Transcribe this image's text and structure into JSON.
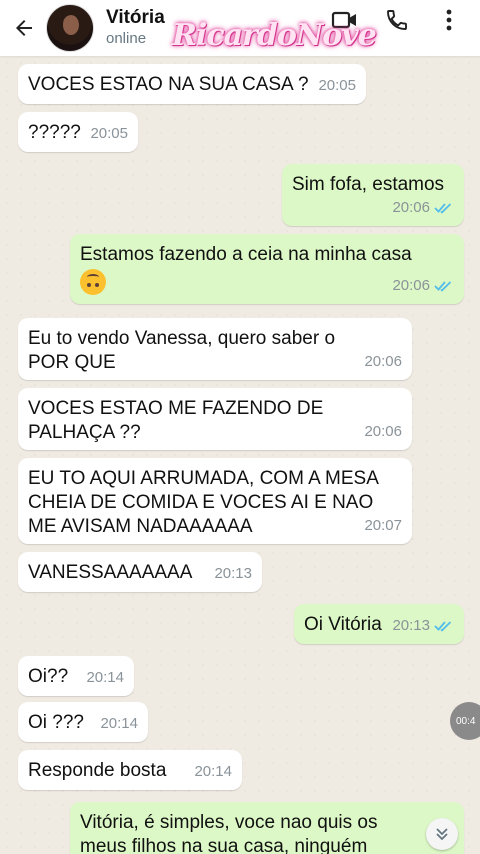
{
  "header": {
    "contact_name": "Vitória",
    "status": "online",
    "watermark": "RicardoNove",
    "icons": [
      "back-arrow-icon",
      "video-call-icon",
      "voice-call-icon",
      "more-options-icon"
    ]
  },
  "messages": [
    {
      "dir": "in",
      "text": "VOCES ESTAO NA SUA CASA ?",
      "time": "20:05"
    },
    {
      "dir": "in",
      "text": "?????",
      "time": "20:05"
    },
    {
      "dir": "out",
      "text": "Sim fofa, estamos",
      "time": "20:06",
      "read": true
    },
    {
      "dir": "out",
      "text": "Estamos fazendo a ceia na minha casa",
      "emoji": "upside-down-face-emoji",
      "time": "20:06",
      "read": true
    },
    {
      "dir": "in",
      "text": "Eu to vendo Vanessa, quero saber o POR QUE",
      "time": "20:06"
    },
    {
      "dir": "in",
      "text": "VOCES ESTAO ME FAZENDO DE PALHAÇA ??",
      "time": "20:06"
    },
    {
      "dir": "in",
      "text": "EU TO AQUI ARRUMADA, COM A MESA CHEIA DE COMIDA E VOCES AI E NAO ME AVISAM NADAAAAAA",
      "time": "20:07"
    },
    {
      "dir": "in",
      "text": "VANESSAAAAAAA",
      "time": "20:13"
    },
    {
      "dir": "out",
      "text": "Oi Vitória",
      "time": "20:13",
      "read": true
    },
    {
      "dir": "in",
      "text": "Oi??",
      "time": "20:14"
    },
    {
      "dir": "in",
      "text": "Oi ???",
      "time": "20:14"
    },
    {
      "dir": "in",
      "text": "Responde bosta",
      "time": "20:14"
    },
    {
      "dir": "out",
      "text": "Vitória, é simples, voce nao quis os meus filhos na sua casa, ninguém concordou",
      "time": "",
      "read": true
    }
  ],
  "overlay": {
    "media_time_partial": "00:4"
  },
  "colors": {
    "incoming": "#ffffff",
    "outgoing": "#dcf8c6",
    "read_ticks": "#53bdeb"
  }
}
